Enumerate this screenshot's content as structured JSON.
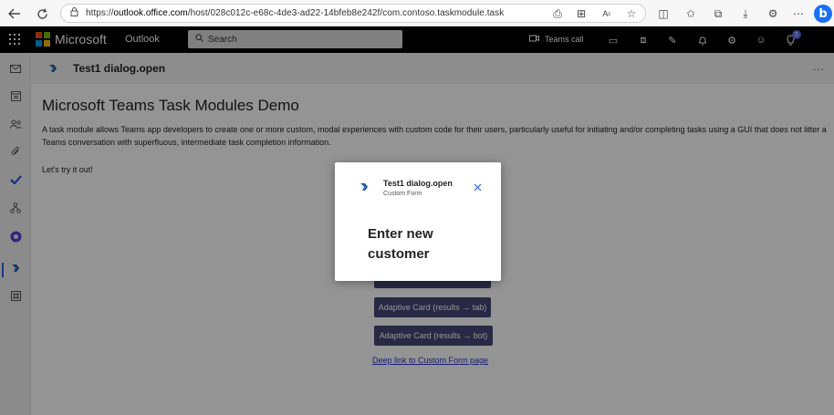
{
  "browser": {
    "url_prefix": "https://",
    "url_host": "outlook.office.com",
    "url_path": "/host/028c012c-e68c-4de3-ad22-14bfeb8e242f/com.contoso.taskmodule.task",
    "bing_label": "b"
  },
  "header": {
    "brand": "Microsoft",
    "app_name": "Outlook",
    "search_placeholder": "Search",
    "teams_call": "Teams call",
    "notification_count": "5"
  },
  "tab": {
    "title": "Test1 dialog.open",
    "more": "..."
  },
  "content": {
    "heading": "Microsoft Teams Task Modules Demo",
    "description": "A task module allows Teams app developers to create one or more custom, modal experiences with custom code for their users, particularly useful for initiating and/or completing tasks using a GUI that does not litter a Teams conversation with superfluous, intermediate task completion information.",
    "lets_try": "Let's try it out!",
    "btn_card_tab": "Adaptive Card (results → tab)",
    "btn_card_bot": "Adaptive Card (results → bot)",
    "deep_link": "Deep link to Custom Form page"
  },
  "dialog": {
    "title": "Test1 dialog.open",
    "subtitle": "Custom Form",
    "body": "Enter new customer"
  },
  "colors": {
    "accent": "#2f5fdc",
    "button": "#464775",
    "header_bg": "#000000",
    "link": "#2b31c8"
  }
}
